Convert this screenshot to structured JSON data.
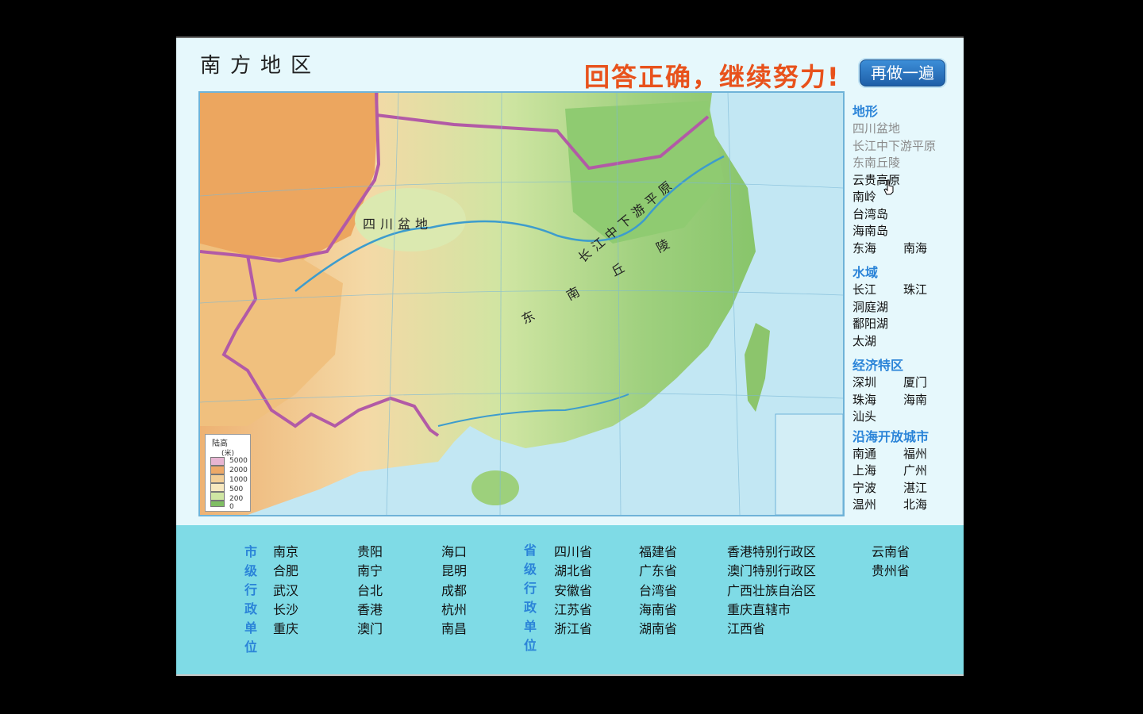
{
  "header": {
    "title": "南方地区",
    "feedback": "回答正确，继续努力!",
    "redo_label": "再做一遍"
  },
  "map": {
    "labels": {
      "sichuan_basin": "四川盆地",
      "yangtze_plain": "长江中下游平原",
      "southeast_hills": "东南丘陵"
    },
    "legend": {
      "title": "陆高",
      "unit": "(米)",
      "levels": [
        {
          "value": "5000",
          "color": "#e7b5d2"
        },
        {
          "value": "2000",
          "color": "#eda968"
        },
        {
          "value": "1000",
          "color": "#f3cf97"
        },
        {
          "value": "500",
          "color": "#f7e8bf"
        },
        {
          "value": "200",
          "color": "#cfe6a3"
        },
        {
          "value": "0",
          "color": "#7fbf63"
        }
      ]
    },
    "colors": {
      "boundary": "#b25aa6",
      "sea": "#c2e7f3",
      "lowland": "#86c56c",
      "highland": "#eba863"
    }
  },
  "sidebar": {
    "terrain": {
      "heading": "地形",
      "done": [
        "四川盆地",
        "长江中下游平原",
        "东南丘陵"
      ],
      "single": [
        "云贵高原",
        "南岭",
        "台湾岛",
        "海南岛"
      ],
      "pair": [
        "东海",
        "南海"
      ]
    },
    "water": {
      "heading": "水域",
      "pair": [
        "长江",
        "珠江"
      ],
      "single": [
        "洞庭湖",
        "鄱阳湖",
        "太湖"
      ]
    },
    "sez": {
      "heading": "经济特区",
      "rows": [
        [
          "深圳",
          "厦门"
        ],
        [
          "珠海",
          "海南"
        ],
        [
          "汕头",
          ""
        ]
      ]
    },
    "coastal": {
      "heading": "沿海开放城市",
      "rows": [
        [
          "南通",
          "福州"
        ],
        [
          "上海",
          "广州"
        ],
        [
          "宁波",
          "湛江"
        ],
        [
          "温州",
          "北海"
        ]
      ]
    }
  },
  "bottom": {
    "city_label": "市级行政单位",
    "province_label": "省级行政单位",
    "cities_col1": [
      "南京",
      "合肥",
      "武汉",
      "长沙",
      "重庆"
    ],
    "cities_col2": [
      "贵阳",
      "南宁",
      "台北",
      "香港",
      "澳门"
    ],
    "cities_col3": [
      "海口",
      "昆明",
      "成都",
      "杭州",
      "南昌"
    ],
    "prov_col1": [
      "四川省",
      "湖北省",
      "安徽省",
      "江苏省",
      "浙江省"
    ],
    "prov_col2": [
      "福建省",
      "广东省",
      "台湾省",
      "海南省",
      "湖南省"
    ],
    "prov_col3": [
      "香港特别行政区",
      "澳门特别行政区",
      "广西壮族自治区",
      "重庆直辖市",
      "江西省"
    ],
    "prov_col4": [
      "云南省",
      "贵州省"
    ]
  }
}
